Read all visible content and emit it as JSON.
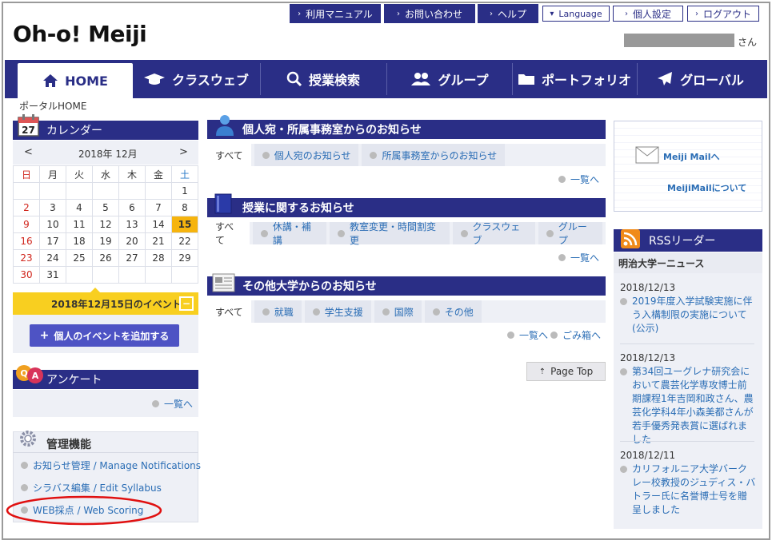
{
  "utility": {
    "manual": "利用マニュアル",
    "contact": "お問い合わせ",
    "help": "ヘルプ",
    "language": "Language",
    "settings": "個人設定",
    "logout": "ログアウト"
  },
  "logo": "Oh-o! Meiji",
  "user_suffix": "さん",
  "nav": {
    "home": "HOME",
    "classweb": "クラスウェブ",
    "search": "授業検索",
    "group": "グループ",
    "portfolio": "ポートフォリオ",
    "global": "グローバル"
  },
  "breadcrumb": "ポータルHOME",
  "calendar": {
    "title": "カレンダー",
    "prev": "<",
    "next": ">",
    "month": "2018年 12月",
    "weekdays": [
      "日",
      "月",
      "火",
      "水",
      "木",
      "金",
      "土"
    ],
    "weeks": [
      [
        "",
        "",
        "",
        "",
        "",
        "",
        "1"
      ],
      [
        "2",
        "3",
        "4",
        "5",
        "6",
        "7",
        "8"
      ],
      [
        "9",
        "10",
        "11",
        "12",
        "13",
        "14",
        "15"
      ],
      [
        "16",
        "17",
        "18",
        "19",
        "20",
        "21",
        "22"
      ],
      [
        "23",
        "24",
        "25",
        "26",
        "27",
        "28",
        "29"
      ],
      [
        "30",
        "31",
        "",
        "",
        "",
        "",
        ""
      ]
    ],
    "today": "15",
    "event_title": "2018年12月15日のイベント",
    "add_event": "個人のイベントを追加する"
  },
  "survey": {
    "title": "アンケート",
    "list_link": "一覧へ"
  },
  "admin": {
    "title": "管理機能",
    "items": [
      "お知らせ管理 / Manage Notifications",
      "シラバス編集 / Edit Syllabus",
      "WEB採点 / Web Scoring"
    ]
  },
  "notices_personal": {
    "title": "個人宛・所属事務室からのお知らせ",
    "tabs": [
      "すべて",
      "個人宛のお知らせ",
      "所属事務室からのお知らせ"
    ],
    "list_link": "一覧へ"
  },
  "notices_class": {
    "title": "授業に関するお知らせ",
    "tabs": [
      "すべて",
      "休講・補講",
      "教室変更・時間割変更",
      "クラスウェブ",
      "グループ"
    ],
    "list_link": "一覧へ"
  },
  "notices_univ": {
    "title": "その他大学からのお知らせ",
    "tabs": [
      "すべて",
      "就職",
      "学生支援",
      "国際",
      "その他"
    ],
    "list_link": "一覧へ",
    "trash_link": "ごみ箱へ"
  },
  "page_top": "Page Top",
  "mail": {
    "link": "Meiji Mailへ",
    "about": "MeijiMailについて"
  },
  "rss": {
    "title": "RSSリーダー",
    "source": "明治大学ーニュース",
    "items": [
      {
        "date": "2018/12/13",
        "text": "2019年度入学試験実施に伴う入構制限の実施について(公示)"
      },
      {
        "date": "2018/12/13",
        "text": "第34回ユーグレナ研究会において農芸化学専攻博士前期課程1年吉岡和政さん、農芸化学科4年小森美都さんが若手優秀発表賞に選ばれました"
      },
      {
        "date": "2018/12/11",
        "text": "カリフォルニア大学バークレー校教授のジュディス・バトラー氏に名誉博士号を贈呈しました"
      }
    ]
  },
  "colors": {
    "navy": "#2a2e86",
    "link": "#2a6db5",
    "highlight": "#f6b40e",
    "annotation": "#e01010"
  }
}
